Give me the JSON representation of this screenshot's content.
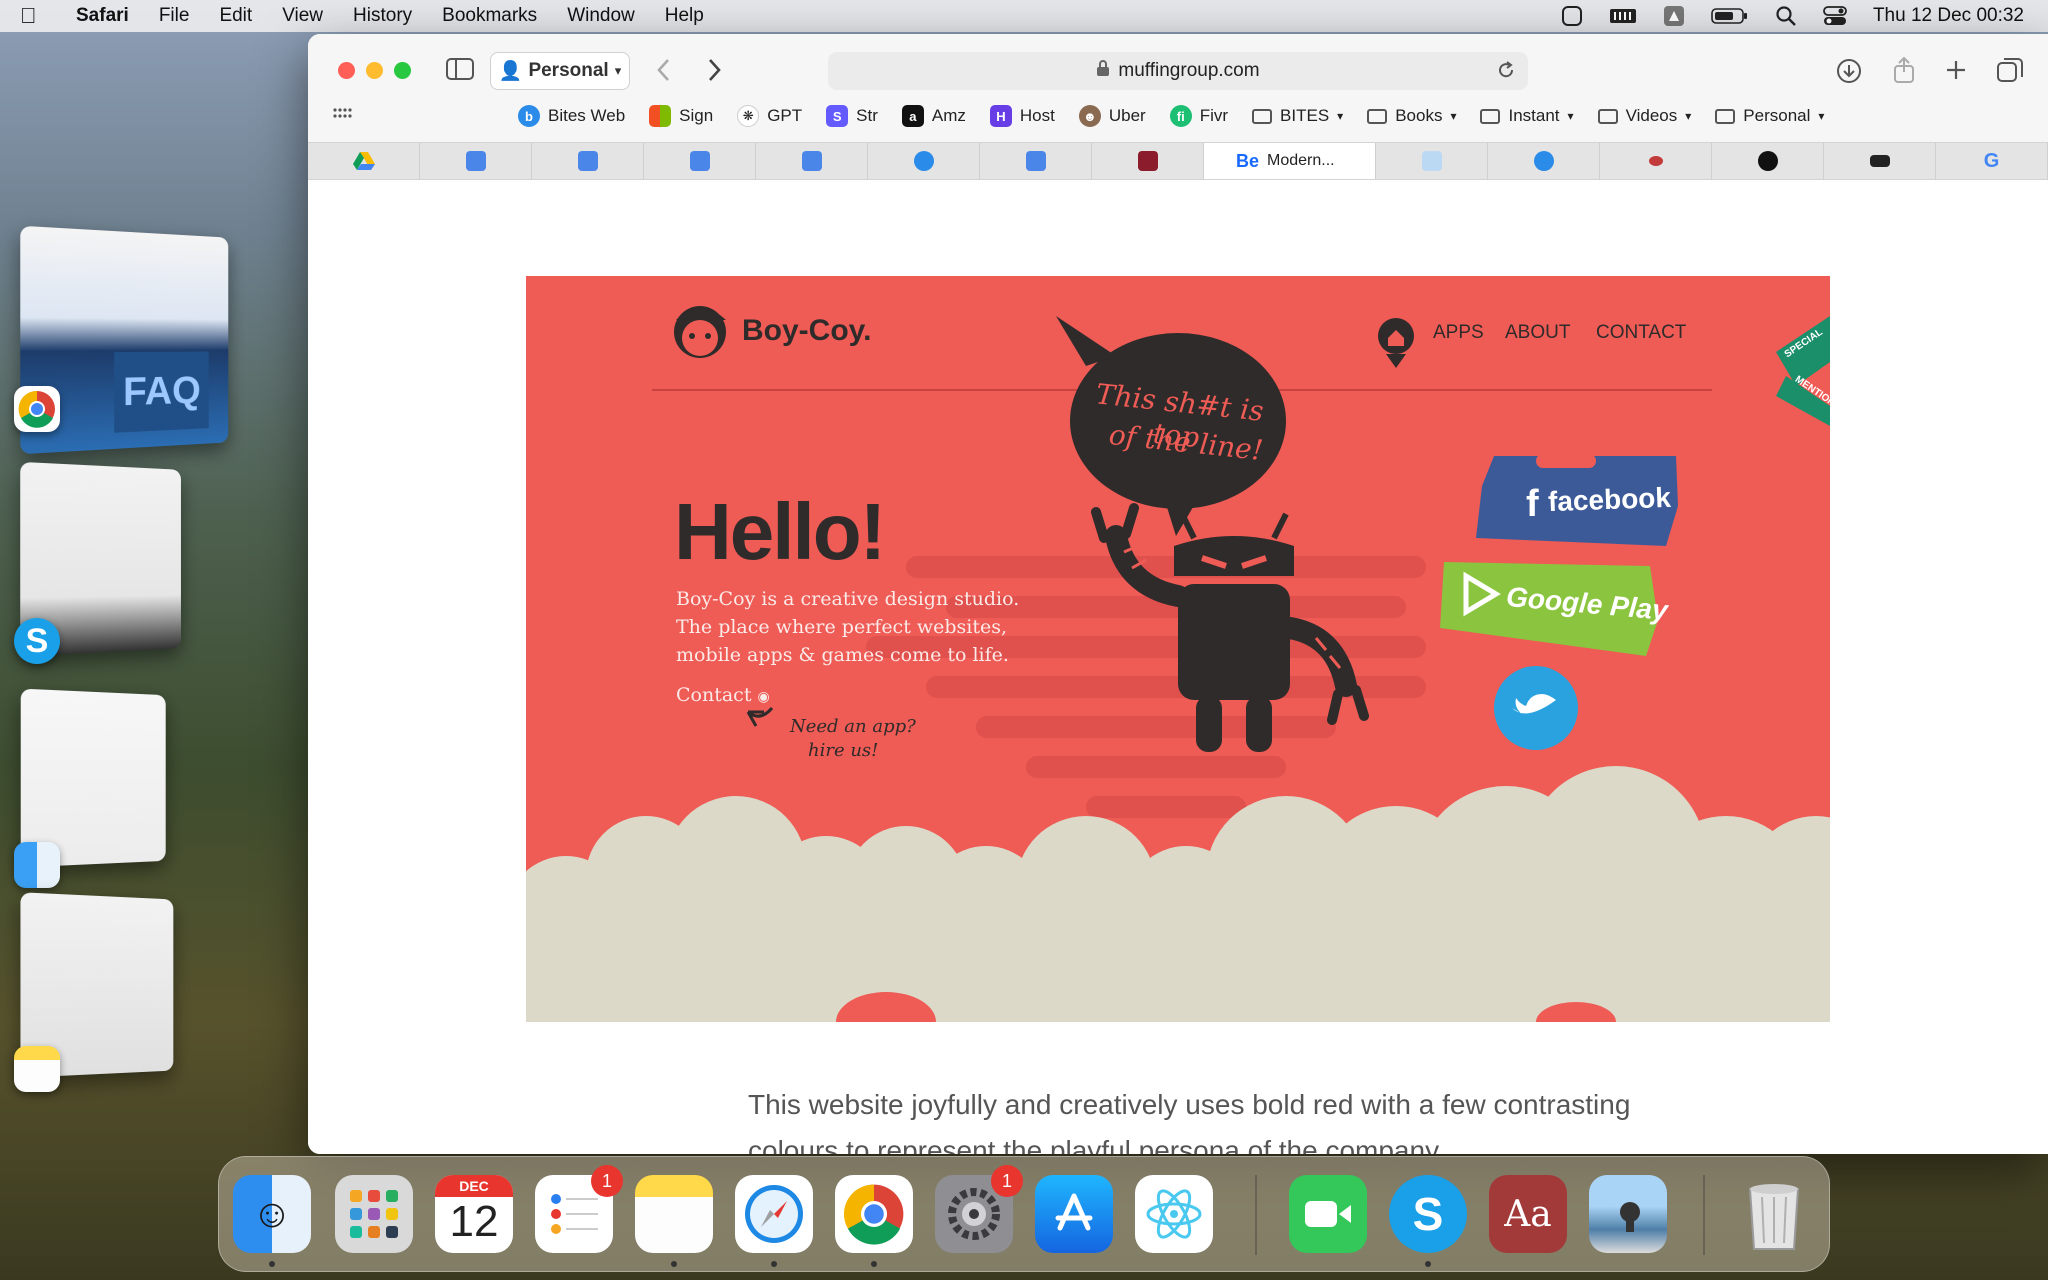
{
  "menubar": {
    "app_name": "Safari",
    "items": [
      "File",
      "Edit",
      "View",
      "History",
      "Bookmarks",
      "Window",
      "Help"
    ],
    "clock": "Thu 12 Dec  00:32"
  },
  "safari": {
    "profile_label": "Personal",
    "url": "muffingroup.com",
    "bookmarks": [
      {
        "label": "Bites Web",
        "icon": "bites-icon",
        "color": "#2a8be8"
      },
      {
        "label": "Sign",
        "icon": "microsoft-icon",
        "color": "#f25022"
      },
      {
        "label": "GPT",
        "icon": "openai-icon",
        "color": "#222222"
      },
      {
        "label": "Str",
        "icon": "stripe-icon",
        "color": "#635bff"
      },
      {
        "label": "Amz",
        "icon": "amazon-icon",
        "color": "#111111"
      },
      {
        "label": "Host",
        "icon": "hostinger-icon",
        "color": "#673de6"
      },
      {
        "label": "Uber",
        "icon": "avatar-icon",
        "color": "#8a6a50"
      },
      {
        "label": "Fivr",
        "icon": "fiverr-icon",
        "color": "#1dbf73"
      }
    ],
    "bookmark_folders": [
      "BITES",
      "Books",
      "Instant",
      "Videos",
      "Personal"
    ],
    "active_tab_label": "Modern...",
    "active_tab_icon_text": "Be"
  },
  "hero": {
    "logo_text": "Boy-Coy.",
    "nav": [
      "APPS",
      "ABOUT",
      "CONTACT"
    ],
    "speech_line1": "This sh#t is top",
    "speech_line2": "of the line!",
    "ribbon_line1": "SPECIAL",
    "ribbon_line2": "MENTION",
    "headline": "Hello!",
    "intro_line1": "Boy-Coy is a creative design studio.",
    "intro_line2": "The place where perfect websites,",
    "intro_line3": "mobile apps & games come to life.",
    "contact_link": "Contact",
    "note_line1": "Need an app?",
    "note_line2": "hire us!",
    "facebook_sign": "facebook",
    "googleplay_sign": "Google Play"
  },
  "caption": "This website joyfully and creatively uses bold red with a few contrasting colours to represent the playful persona of the company.",
  "dock": {
    "calendar_month": "DEC",
    "calendar_day": "12",
    "reminders_badge": "1",
    "settings_badge": "1",
    "dictionary_label": "Aa"
  },
  "colors": {
    "hero_red": "#ef5b55",
    "dark_ink": "#2f2b2b",
    "cloud": "#dcd9c8",
    "twitter_blue": "#2aa2e0",
    "facebook_blue": "#3d5a98",
    "googleplay_green": "#8bc53f"
  }
}
